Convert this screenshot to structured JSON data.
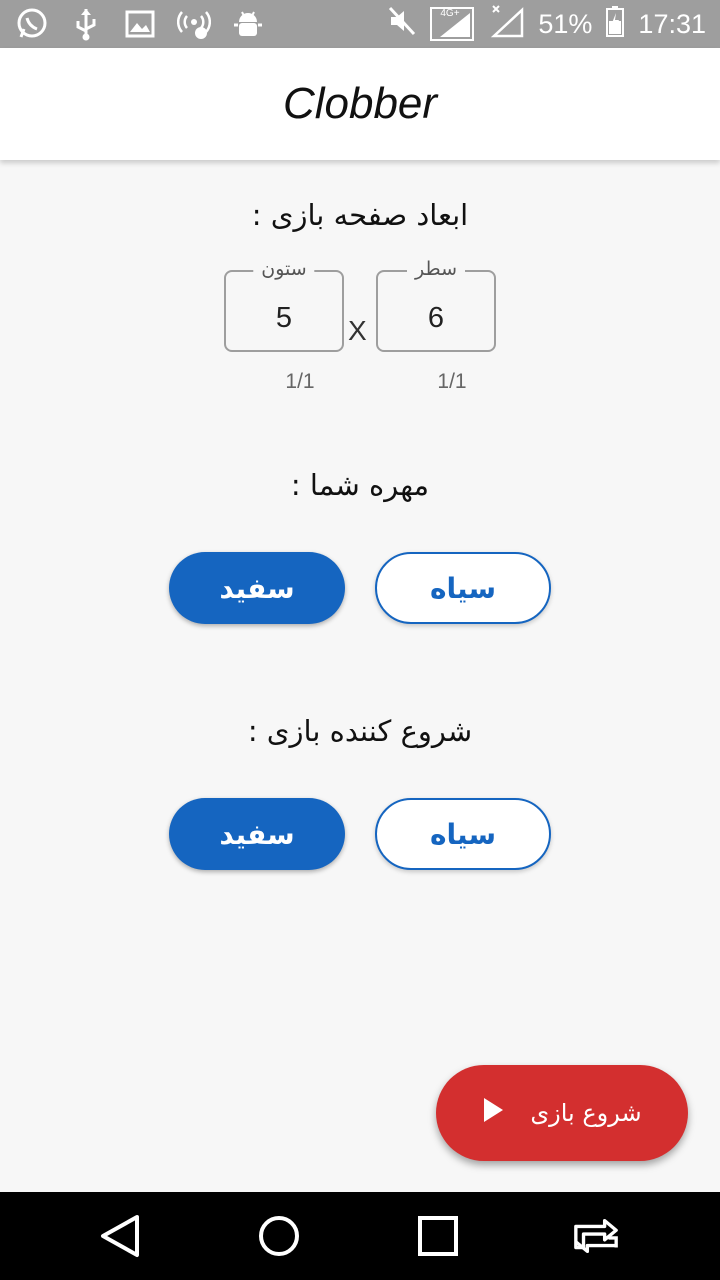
{
  "status_bar": {
    "icons_left": [
      "whatsapp-icon",
      "usb-icon",
      "image-icon",
      "hotspot-icon",
      "android-debug-icon"
    ],
    "icons_right": [
      "mute-icon",
      "signal-4g-icon",
      "no-sim-icon"
    ],
    "network_label": "4G+",
    "battery_percent": "51%",
    "time": "17:31"
  },
  "app_bar": {
    "title": "Clobber"
  },
  "board_size": {
    "title": "ابعاد صفحه بازی :",
    "columns": {
      "label": "ستون",
      "value": "5",
      "counter": "1/1"
    },
    "separator": "X",
    "rows": {
      "label": "سطر",
      "value": "6",
      "counter": "1/1"
    }
  },
  "your_piece": {
    "title": "مهره شما :",
    "white_label": "سفید",
    "black_label": "سیاه",
    "selected": "white"
  },
  "starter": {
    "title": "شروع کننده بازی :",
    "white_label": "سفید",
    "black_label": "سیاه",
    "selected": "white"
  },
  "fab": {
    "label": "شروع بازی",
    "icon": "play-icon"
  },
  "colors": {
    "primary": "#1565c0",
    "accent": "#d32f2f",
    "status_bar": "#9e9e9e"
  },
  "nav_bar": {
    "buttons": [
      "back-icon",
      "home-icon",
      "recents-icon",
      "switch-apps-icon"
    ]
  }
}
